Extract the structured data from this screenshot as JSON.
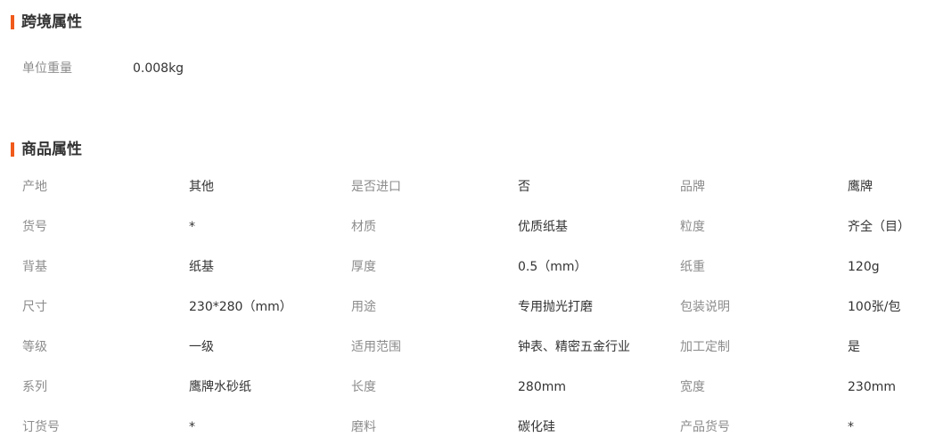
{
  "cross_border": {
    "title": "跨境属性",
    "attributes": [
      {
        "label": "单位重量",
        "value": "0.008kg"
      }
    ]
  },
  "product": {
    "title": "商品属性",
    "rows": [
      [
        {
          "label": "产地",
          "value": "其他"
        },
        {
          "label": "是否进口",
          "value": "否"
        },
        {
          "label": "品牌",
          "value": "鹰牌"
        }
      ],
      [
        {
          "label": "货号",
          "value": "*"
        },
        {
          "label": "材质",
          "value": "优质纸基"
        },
        {
          "label": "粒度",
          "value": "齐全（目）"
        }
      ],
      [
        {
          "label": "背基",
          "value": "纸基"
        },
        {
          "label": "厚度",
          "value": "0.5（mm）"
        },
        {
          "label": "纸重",
          "value": "120g"
        }
      ],
      [
        {
          "label": "尺寸",
          "value": "230*280（mm）"
        },
        {
          "label": "用途",
          "value": "专用抛光打磨"
        },
        {
          "label": "包装说明",
          "value": "100张/包"
        }
      ],
      [
        {
          "label": "等级",
          "value": "一级"
        },
        {
          "label": "适用范围",
          "value": "钟表、精密五金行业"
        },
        {
          "label": "加工定制",
          "value": "是"
        }
      ],
      [
        {
          "label": "系列",
          "value": "鹰牌水砂纸"
        },
        {
          "label": "长度",
          "value": "280mm"
        },
        {
          "label": "宽度",
          "value": "230mm"
        }
      ],
      [
        {
          "label": "订货号",
          "value": "*"
        },
        {
          "label": "磨料",
          "value": "碳化硅"
        },
        {
          "label": "产品货号",
          "value": "*"
        }
      ]
    ]
  }
}
